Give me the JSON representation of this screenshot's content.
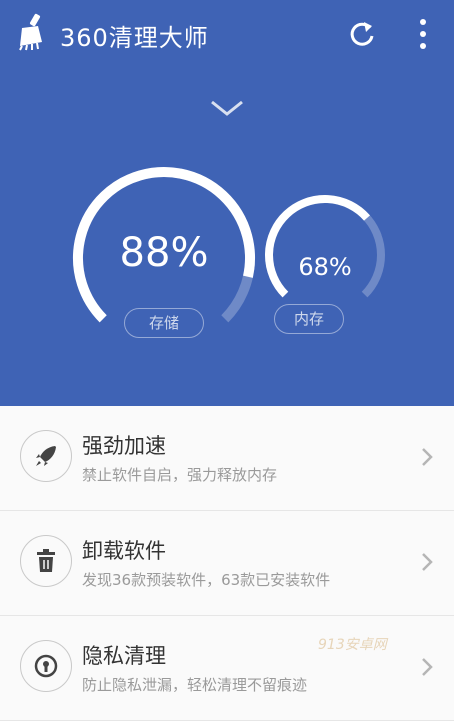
{
  "colors": {
    "primary": "#3f63b5",
    "text_dark": "#333333",
    "text_sub": "#9a9a9a"
  },
  "header": {
    "title": "360清理大师",
    "icons": {
      "app": "broom-icon",
      "refresh": "refresh-icon",
      "more": "more-vertical-icon"
    }
  },
  "hero": {
    "expand_icon": "chevron-down-icon",
    "storage": {
      "value_text": "88%",
      "fraction": 0.88,
      "label": "存储"
    },
    "memory": {
      "value_text": "68%",
      "fraction": 0.68,
      "label": "内存"
    }
  },
  "features": [
    {
      "title": "强劲加速",
      "subtitle": "禁止软件自启，强力释放内存",
      "icon": "rocket-icon"
    },
    {
      "title": "卸载软件",
      "subtitle": "发现36款预装软件，63款已安装软件",
      "icon": "trash-icon"
    },
    {
      "title": "隐私清理",
      "subtitle": "防止隐私泄漏，轻松清理不留痕迹",
      "icon": "lock-icon"
    }
  ],
  "watermark": "913安卓网"
}
